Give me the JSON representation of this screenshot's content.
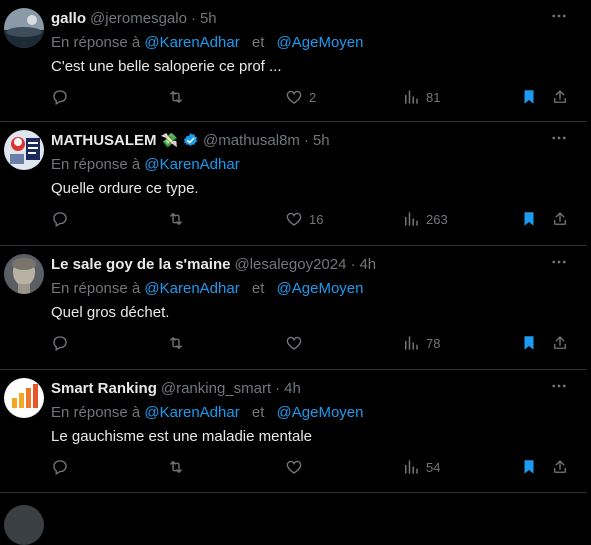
{
  "tweets": [
    {
      "name": "gallo",
      "handle": "@jeromesgalo",
      "time": "5h",
      "reply_prefix": "En réponse à",
      "mentions": [
        "@KarenAdhar",
        "@AgeMoyen"
      ],
      "mention_sep": "et",
      "text": "C'est une belle saloperie ce prof ...",
      "likes": "2",
      "views": "81",
      "verified": false,
      "emoji": ""
    },
    {
      "name": "MATHUSALEM",
      "handle": "@mathusal8m",
      "time": "5h",
      "reply_prefix": "En réponse à",
      "mentions": [
        "@KarenAdhar"
      ],
      "mention_sep": "",
      "text": "Quelle ordure ce type.",
      "likes": "16",
      "views": "263",
      "verified": true,
      "emoji": "💸"
    },
    {
      "name": "Le sale goy de la s'maine",
      "handle": "@lesalegoy2024",
      "time": "4h",
      "reply_prefix": "En réponse à",
      "mentions": [
        "@KarenAdhar",
        "@AgeMoyen"
      ],
      "mention_sep": "et",
      "text": "Quel gros déchet.",
      "likes": "",
      "views": "78",
      "verified": false,
      "emoji": ""
    },
    {
      "name": "Smart Ranking",
      "handle": "@ranking_smart",
      "time": "4h",
      "reply_prefix": "En réponse à",
      "mentions": [
        "@KarenAdhar",
        "@AgeMoyen"
      ],
      "mention_sep": "et",
      "text": "Le gauchisme est une maladie mentale",
      "likes": "",
      "views": "54",
      "verified": false,
      "emoji": ""
    }
  ],
  "colors": {
    "background": "#000000",
    "text": "#e7e9ea",
    "muted": "#71767b",
    "accent": "#1d9bf0",
    "divider": "#2f3336"
  }
}
